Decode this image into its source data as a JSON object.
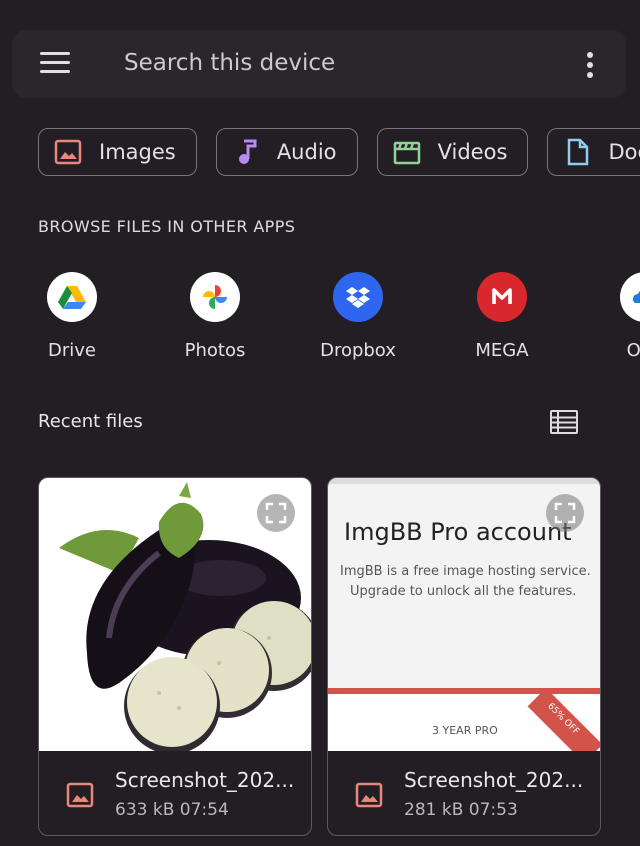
{
  "search": {
    "placeholder": "Search this device"
  },
  "categories": [
    {
      "label": "Images",
      "icon": "image-icon",
      "color": "#e8877a"
    },
    {
      "label": "Audio",
      "icon": "music-note-icon",
      "color": "#b78cf0"
    },
    {
      "label": "Videos",
      "icon": "clapperboard-icon",
      "color": "#8fd39a"
    },
    {
      "label": "Docur",
      "icon": "document-icon",
      "color": "#8ecdf0"
    }
  ],
  "browse": {
    "title": "BROWSE FILES IN OTHER APPS",
    "apps": [
      {
        "name": "Drive",
        "icon": "google-drive-icon"
      },
      {
        "name": "Photos",
        "icon": "google-photos-icon"
      },
      {
        "name": "Dropbox",
        "icon": "dropbox-icon",
        "color": "#2f66f0"
      },
      {
        "name": "MEGA",
        "icon": "mega-icon",
        "color": "#d9272e"
      },
      {
        "name": "One",
        "icon": "onedrive-icon"
      }
    ]
  },
  "recent": {
    "title": "Recent files",
    "files": [
      {
        "name": "Screenshot_202...",
        "size": "633 kB",
        "time": "07:54",
        "thumbnail": "eggplant-photo"
      },
      {
        "name": "Screenshot_202...",
        "size": "281 kB",
        "time": "07:53",
        "thumbnail": "imgbb-promo",
        "preview": {
          "heading": "ImgBB Pro account",
          "line1": "ImgBB is a free image hosting service.",
          "line2": "Upgrade to unlock all the features.",
          "plan": "3 YEAR PRO",
          "ribbon": "65% OFF"
        }
      }
    ]
  }
}
